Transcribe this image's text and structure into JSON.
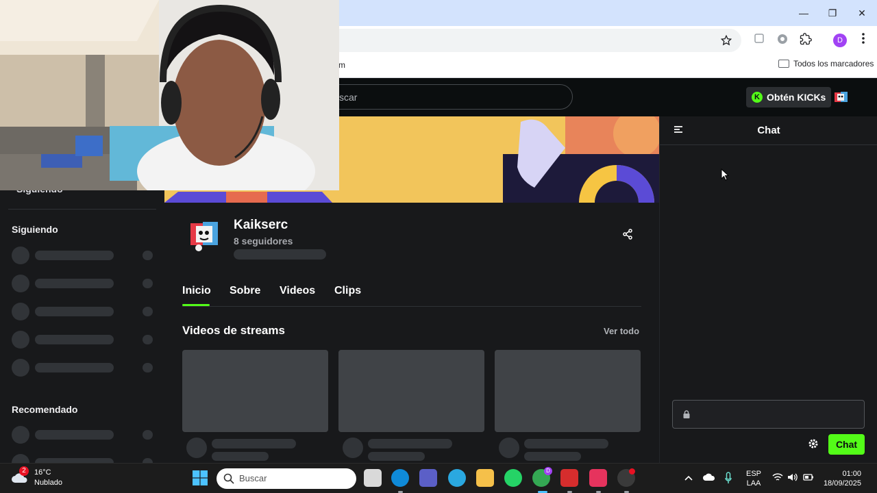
{
  "browser": {
    "window_controls": {
      "minimize": "—",
      "restore": "❐",
      "close": "✕"
    },
    "profile_initial": "D",
    "bookmarks_partial": "m",
    "bookmarks_all": "Todos los marcadores"
  },
  "kick_header": {
    "search_placeholder_partial": "scar",
    "kicks_button_label": "Obtén KICKs",
    "kicks_icon_letter": "K"
  },
  "sidebar": {
    "siguiendo_top": "Siguiendo",
    "following_heading": "Siguiendo",
    "recommended_heading": "Recomendado"
  },
  "channel": {
    "name": "Kaikserc",
    "followers": "8 seguidores",
    "tabs": [
      "Inicio",
      "Sobre",
      "Videos",
      "Clips"
    ],
    "active_tab": "Inicio",
    "section_title": "Videos de streams",
    "see_all": "Ver todo",
    "accent_color": "#53fc18"
  },
  "chat": {
    "title": "Chat",
    "send_label": "Chat"
  },
  "taskbar": {
    "weather_temp": "16°C",
    "weather_desc": "Nublado",
    "weather_badge": "2",
    "search_placeholder": "Buscar",
    "lang_top": "ESP",
    "lang_bottom": "LAA",
    "time": "01:00",
    "date": "18/09/2025",
    "chrome_badge": "D"
  }
}
